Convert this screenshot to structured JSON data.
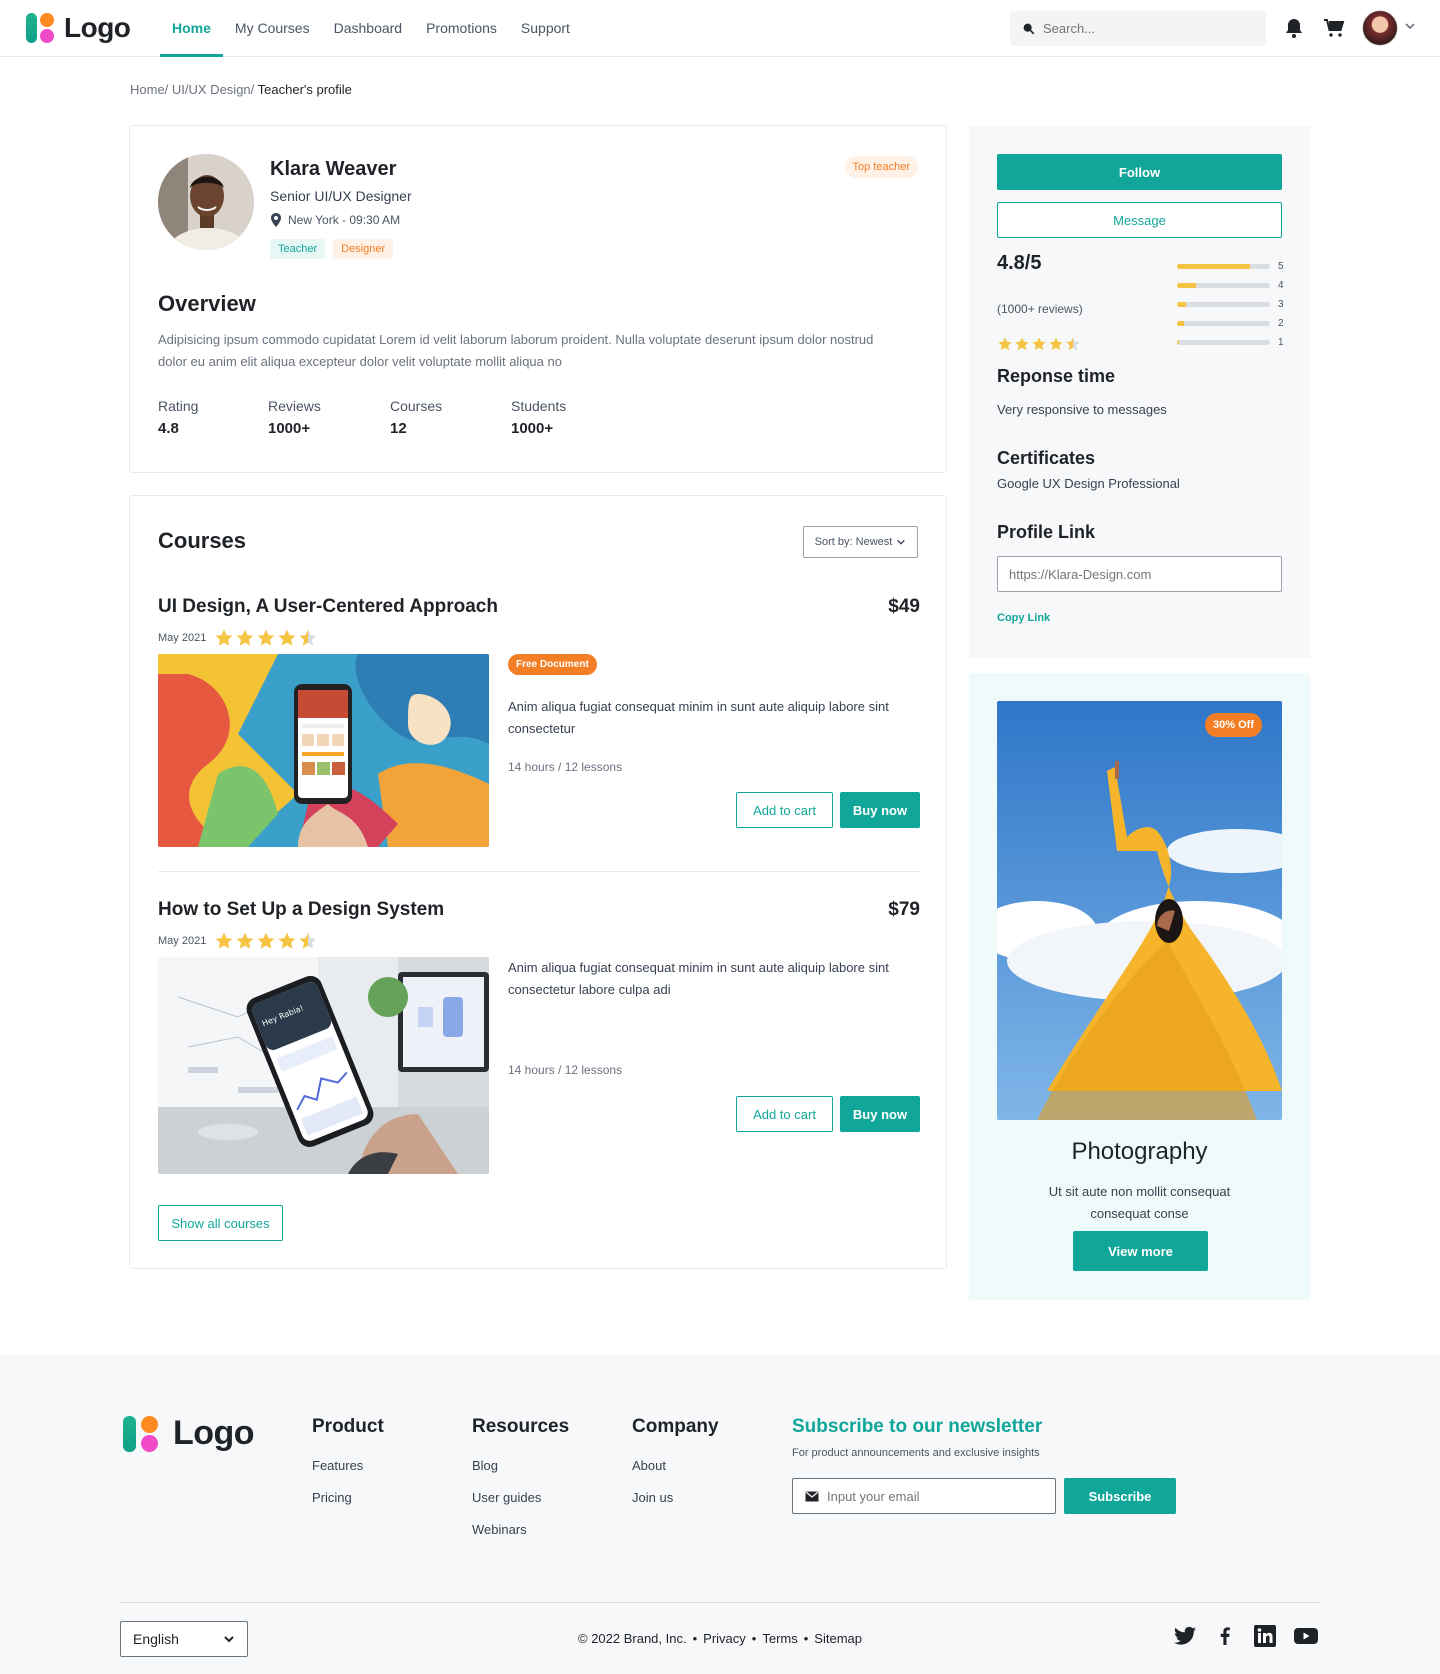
{
  "header": {
    "logo_text": "Logo",
    "nav": [
      "Home",
      "My Courses",
      "Dashboard",
      "Promotions",
      "Support"
    ],
    "search_placeholder": "Search..."
  },
  "breadcrumb": {
    "path": "Home/ UI/UX Design/",
    "current": " Teacher's profile"
  },
  "profile": {
    "name": "Klara Weaver",
    "role": "Senior UI/UX Designer",
    "location": "New York - 09:30 AM",
    "tags": [
      "Teacher",
      "Designer"
    ],
    "badge": "Top teacher",
    "overview_title": "Overview",
    "overview_text": "Adipisicing ipsum commodo cupidatat Lorem id velit laborum laborum proident. Nulla voluptate deserunt ipsum dolor nostrud dolor eu anim elit aliqua excepteur dolor velit voluptate mollit aliqua no",
    "stats": [
      {
        "label": "Rating",
        "value": "4.8"
      },
      {
        "label": "Reviews",
        "value": "1000+"
      },
      {
        "label": "Courses",
        "value": "12"
      },
      {
        "label": "Students",
        "value": "1000+"
      }
    ]
  },
  "courses": {
    "title": "Courses",
    "sort_label": "Sort by: Newest",
    "items": [
      {
        "title": "UI Design, A User-Centered Approach",
        "price": "$49",
        "date": "May 2021",
        "rating": 4.5,
        "badge": "Free Document",
        "desc": "Anim aliqua fugiat consequat minim in sunt aute aliquip labore sint consectetur",
        "duration": "14 hours  /  12 lessons",
        "add_label": "Add to cart",
        "buy_label": "Buy now"
      },
      {
        "title": "How to Set Up a Design System",
        "price": "$79",
        "date": "May 2021",
        "rating": 4.5,
        "desc": "Anim aliqua fugiat consequat minim in sunt aute aliquip labore sint consectetur labore culpa adi",
        "duration": "14 hours  /  12 lessons",
        "add_label": "Add to cart",
        "buy_label": "Buy now"
      }
    ],
    "show_all_label": "Show all courses"
  },
  "sidebar": {
    "follow_label": "Follow",
    "message_label": "Message",
    "rating": "4.8/5",
    "reviews": "(1000+ reviews)",
    "stars": 4.5,
    "distribution": [
      {
        "star": "5",
        "fraction": 0.78
      },
      {
        "star": "4",
        "fraction": 0.2
      },
      {
        "star": "3",
        "fraction": 0.1
      },
      {
        "star": "2",
        "fraction": 0.08
      },
      {
        "star": "1",
        "fraction": 0.02
      }
    ],
    "response_title": "Reponse time",
    "response_text": "Very responsive to messages",
    "cert_title": "Certificates",
    "cert_text": "Google UX Design Professional",
    "link_title": "Profile Link",
    "link_placeholder": "https://Klara-Design.com",
    "copy_label": "Copy Link"
  },
  "promo": {
    "off_label": "30% Off",
    "title": "Photography",
    "text": "Ut sit aute non mollit consequat consequat conse",
    "button_label": "View more"
  },
  "footer": {
    "logo_text": "Logo",
    "columns": [
      {
        "title": "Product",
        "links": [
          "Features",
          "Pricing"
        ]
      },
      {
        "title": "Resources",
        "links": [
          "Blog",
          "User guides",
          "Webinars"
        ]
      },
      {
        "title": "Company",
        "links": [
          "About",
          "Join us"
        ]
      }
    ],
    "newsletter_title": "Subscribe to our newsletter",
    "newsletter_sub": "For product announcements and exclusive insights",
    "email_placeholder": "Input your email",
    "subscribe_label": "Subscribe",
    "language": "English",
    "copyright": "© 2022 Brand, Inc.",
    "legal": [
      "Privacy",
      "Terms",
      "Sitemap"
    ],
    "socials": [
      "twitter-icon",
      "facebook-icon",
      "linkedin-icon",
      "youtube-icon"
    ]
  },
  "colors": {
    "accent": "#11a69a",
    "orange": "#f47e25",
    "star": "#f5c443"
  }
}
